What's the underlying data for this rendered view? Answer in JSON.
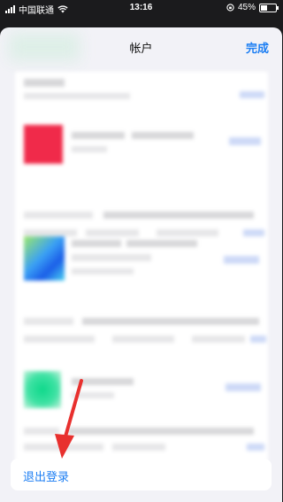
{
  "status_bar": {
    "carrier": "中国联通",
    "time": "13:16",
    "battery_percent": "45%",
    "battery_level": 0.45
  },
  "header": {
    "title": "帐户",
    "done_label": "完成"
  },
  "logout": {
    "label": "退出登录"
  },
  "colors": {
    "accent": "#1c7ef3",
    "annotation_arrow": "#e8302e",
    "sheet_bg": "#f2f2f7"
  },
  "icons": [
    "signal-icon",
    "wifi-icon",
    "lock-rotation-icon",
    "battery-icon",
    "red-arrow-annotation"
  ]
}
